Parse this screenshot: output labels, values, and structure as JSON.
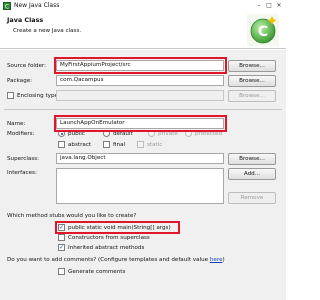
{
  "window": {
    "title": "New Java Class"
  },
  "header": {
    "title": "Java Class",
    "description": "Create a new Java class."
  },
  "source_folder": {
    "label": "Source folder:",
    "value": "MyFirstAppiumProject/src",
    "browse": "Browse..."
  },
  "package": {
    "label": "Package:",
    "value": "com.Qacampus",
    "browse": "Browse..."
  },
  "enclosing_type": {
    "label": "Enclosing type:",
    "value": "",
    "browse": "Browse..."
  },
  "name": {
    "label": "Name:",
    "value": "LaunchAppOnEmulator"
  },
  "modifiers": {
    "label": "Modifiers:",
    "radios": [
      "public",
      "default",
      "private",
      "protected"
    ],
    "checks": [
      "abstract",
      "final",
      "static"
    ]
  },
  "superclass": {
    "label": "Superclass:",
    "value": "java.lang.Object",
    "browse": "Browse..."
  },
  "interfaces": {
    "label": "Interfaces:",
    "add": "Add...",
    "remove": "Remove"
  },
  "stubs": {
    "question": "Which method stubs would you like to create?",
    "options": [
      "public static void main(String[] args)",
      "Constructors from superclass",
      "Inherited abstract methods"
    ]
  },
  "comments": {
    "question_before": "Do you want to add comments? (Configure templates and default value ",
    "link": "here",
    "question_after": ")",
    "option": "Generate comments"
  },
  "colors": {
    "highlight": "#e0162b",
    "dialog_bg": "#f0f0f0"
  },
  "icons": [
    "java-class-window-icon",
    "new-class-wizard-logo"
  ]
}
